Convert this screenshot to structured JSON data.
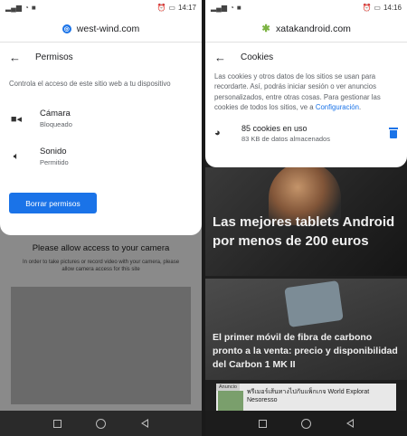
{
  "left": {
    "status": {
      "time": "14:17"
    },
    "url": "west-wind.com",
    "header_title": "Permisos",
    "description": "Controla el acceso de este sitio web a tu dispositivo",
    "permissions": [
      {
        "name": "Cámara",
        "state": "Bloqueado",
        "icon": "camera-icon"
      },
      {
        "name": "Sonido",
        "state": "Permitido",
        "icon": "speaker-icon"
      }
    ],
    "button_label": "Borrar permisos",
    "background_page": {
      "title": "Please allow access to your camera",
      "body": "In order to take pictures or record video with your camera, please allow camera access for this site"
    }
  },
  "right": {
    "status": {
      "time": "14:16"
    },
    "url": "xatakandroid.com",
    "header_title": "Cookies",
    "description_part1": "Las cookies y otros datos de los sitios se usan para recordarte. Así, podrás iniciar sesión o ver anuncios personalizados, entre otras cosas. Para gestionar las cookies de todos los sitios, ve a ",
    "description_link": "Configuración",
    "description_part2": ".",
    "cookies_count": "85 cookies en uso",
    "cookies_meta": "83 KB de datos almacenados",
    "article1_title": "Las mejores tablets Android por menos de 200 euros",
    "article2_title": "El primer móvil de fibra de carbono pronto a la venta: precio y disponibilidad del Carbon 1 MK II",
    "ad": {
      "label": "Anuncio",
      "text": "พรีเมอร์เส้นทางไปกับแพ็กเกจ World Explorat",
      "brand": "Nesoresso"
    }
  },
  "colors": {
    "accent": "#1a73e8",
    "text_primary": "#202124",
    "text_secondary": "#5f6368"
  }
}
